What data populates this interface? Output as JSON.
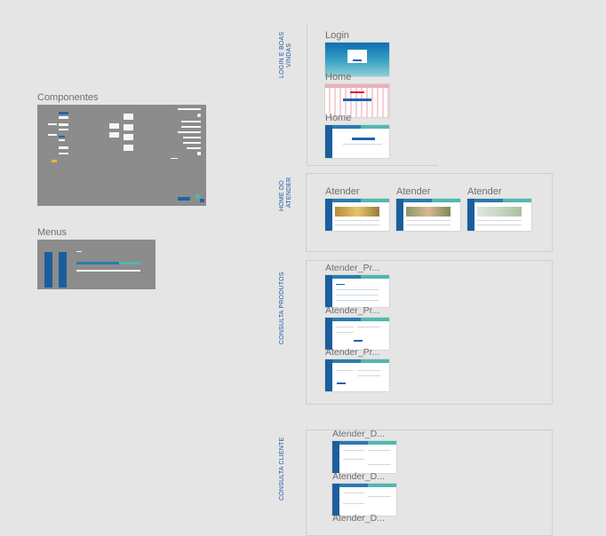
{
  "canvas": {
    "background": "#e5e5e5",
    "accent_blue": "#1b5e9e",
    "accent_teal": "#4fb8b0"
  },
  "left_frames": {
    "componentes": "Componentes",
    "menus": "Menus"
  },
  "sections": [
    {
      "label": "LOGIN E BOAS VINDAS",
      "label_line1": "LOGIN E BOAS",
      "label_line2": "VINDAS",
      "frames": [
        "Login",
        "Home",
        "Home"
      ]
    },
    {
      "label": "HOME DO ATENDER",
      "label_line1": "HOME DO",
      "label_line2": "ATENDER",
      "frames": [
        "Atender",
        "Atender",
        "Atender"
      ]
    },
    {
      "label": "CONSULTA PRODUTOS",
      "frames": [
        "Atender_Pr...",
        "Atender_Pr...",
        "Atender_Pr..."
      ]
    },
    {
      "label": "CONSULTA CLIENTE",
      "frames": [
        "Atender_D...",
        "Atender_D...",
        "Atender_D..."
      ]
    }
  ]
}
